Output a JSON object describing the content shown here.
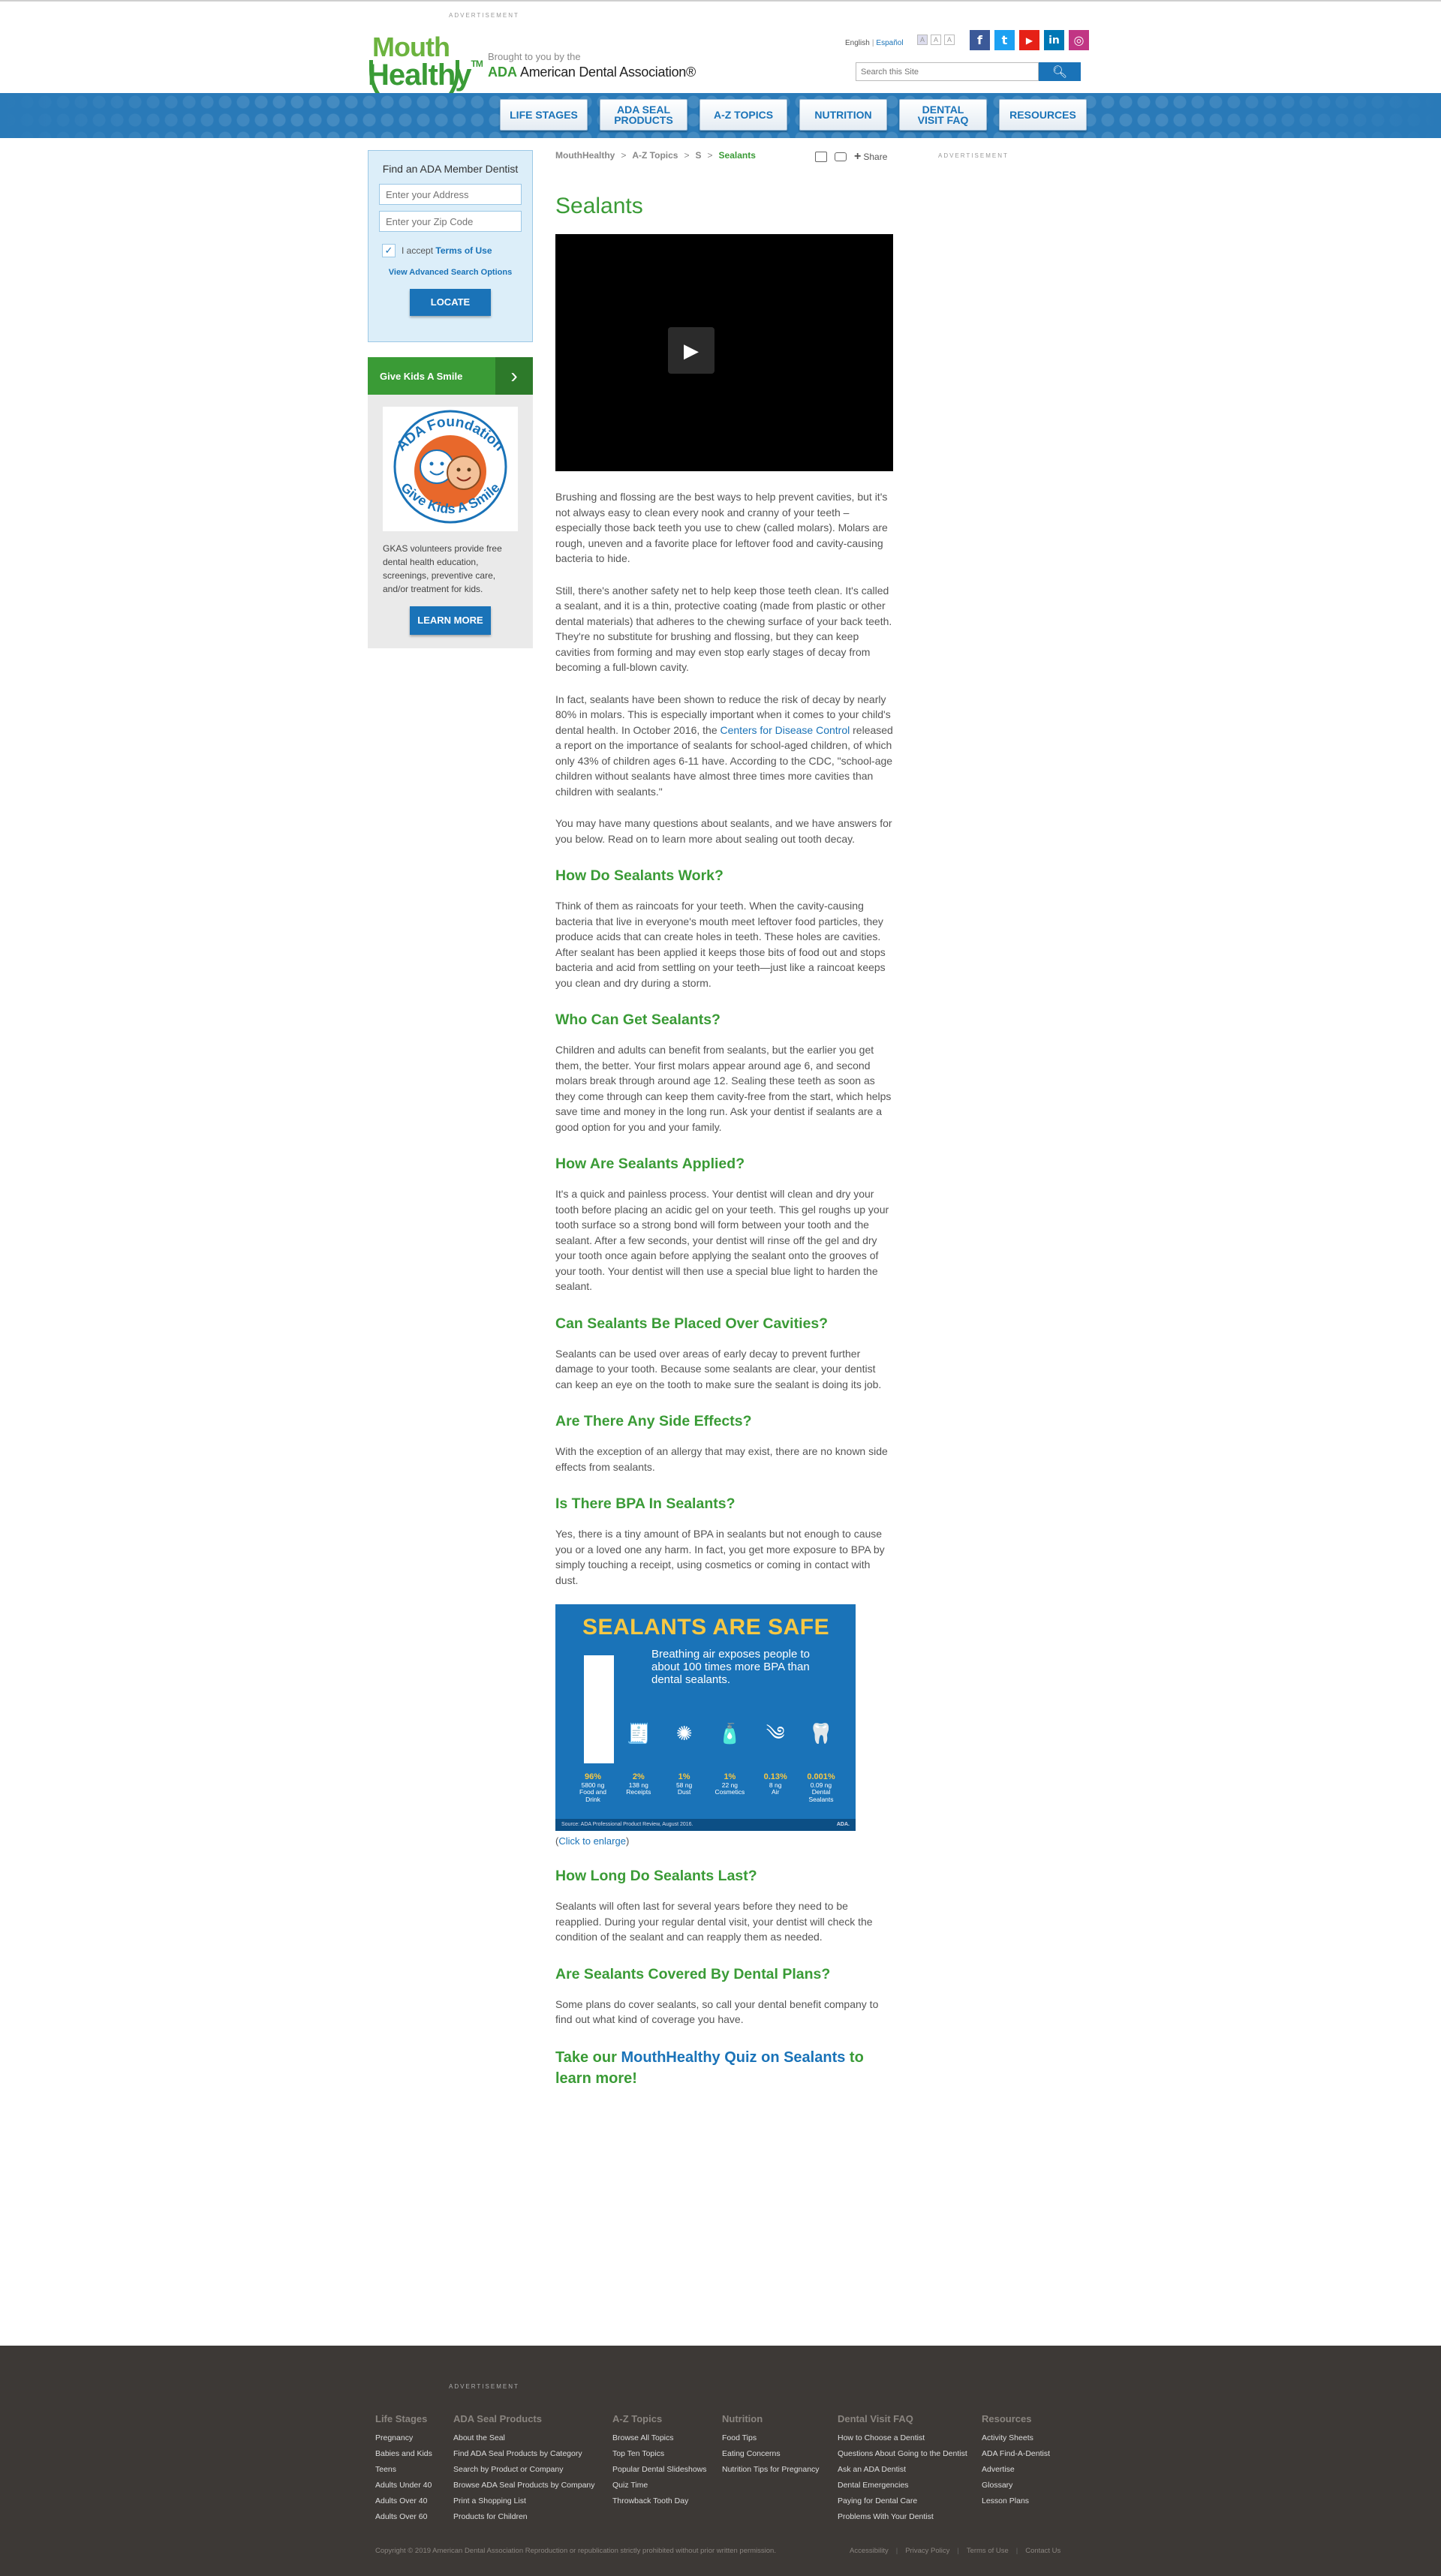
{
  "header": {
    "advertisement_label": "ADVERTISEMENT",
    "logo_line1": "Mouth",
    "logo_line2": "Healthy",
    "logo_tm": "TM",
    "brought_by": "Brought to you by the",
    "ada_short": "ADA",
    "ada_name": "American Dental Association®",
    "lang_english": "English",
    "lang_espanol": "Español",
    "font_sizes": [
      "A",
      "A",
      "A"
    ],
    "social": [
      {
        "name": "facebook",
        "glyph": "f",
        "color": "#3b5998"
      },
      {
        "name": "twitter",
        "glyph": "t",
        "color": "#1da1f2"
      },
      {
        "name": "youtube",
        "glyph": "▶",
        "color": "#e62117"
      },
      {
        "name": "linkedin",
        "glyph": "in",
        "color": "#0077b5"
      },
      {
        "name": "instagram",
        "glyph": "◎",
        "color": "#c13584"
      }
    ],
    "search_placeholder": "Search this Site"
  },
  "nav": {
    "items": [
      "LIFE STAGES",
      "ADA SEAL PRODUCTS",
      "A-Z TOPICS",
      "NUTRITION",
      "DENTAL VISIT FAQ",
      "RESOURCES"
    ]
  },
  "sidebar": {
    "finder_title": "Find an ADA Member Dentist",
    "address_placeholder": "Enter your Address",
    "zip_placeholder": "Enter your Zip Code",
    "accept_text": "I accept",
    "terms_link": "Terms of Use",
    "advanced": "View Advanced Search Options",
    "locate": "LOCATE",
    "gkas_banner": "Give Kids A Smile",
    "gkas_logo_top": "ADA Foundation",
    "gkas_logo_bottom": "Give Kids A Smile",
    "gkas_text": "GKAS volunteers provide free dental health education, screenings, preventive care, and/or treatment for kids.",
    "learn_more": "LEARN MORE"
  },
  "breadcrumb": [
    "MouthHealthy",
    "A-Z Topics",
    "S",
    "Sealants"
  ],
  "tools": {
    "share": "Share"
  },
  "right_ad_label": "ADVERTISEMENT",
  "article": {
    "title": "Sealants",
    "p1": "Brushing and flossing are the best ways to help prevent cavities, but it's not always easy to clean every nook and cranny of your teeth – especially those back teeth you use to chew (called molars). Molars are rough, uneven and a favorite place for leftover food and cavity-causing bacteria to hide.",
    "p2": "Still, there's another safety net to help keep those teeth clean. It's called a sealant, and it is a thin, protective coating (made from plastic or other dental materials) that adheres to the chewing surface of your back teeth. They're no substitute for brushing and flossing, but they can keep cavities from forming and may even stop early stages of decay from becoming a full-blown cavity.",
    "p3_a": "In fact, sealants have been shown to reduce the risk of decay by nearly 80% in molars. This is especially important when it comes to your child's dental health. In October 2016, the ",
    "p3_link": "Centers for Disease Control",
    "p3_b": " released a report on the importance of sealants for school-aged children, of which only 43% of children ages 6-11 have. According to the CDC, \"school-age children without sealants have almost three times more cavities than children with sealants.\"",
    "p4": "You may have many questions about sealants, and we have answers for you below. Read on to learn more about sealing out tooth decay.",
    "h_work": "How Do Sealants Work?",
    "p_work": "Think of them as raincoats for your teeth. When the cavity-causing bacteria that live in everyone's mouth meet leftover food particles, they produce acids that can create holes in teeth. These holes are cavities. After sealant has been applied it keeps those bits of food out and stops bacteria and acid from settling on your teeth—just like a raincoat keeps you clean and dry during a storm.",
    "h_who": "Who Can Get Sealants?",
    "p_who": "Children and adults can benefit from sealants, but the earlier you get them, the better. Your first molars appear around age 6, and second molars break through around age 12. Sealing these teeth as soon as they come through can keep them cavity-free from the start, which helps save time and money in the long run. Ask your dentist if sealants are a good option for you and your family.",
    "h_applied": "How Are Sealants Applied?",
    "p_applied": "It's a quick and painless process. Your dentist will clean and dry your tooth before placing an acidic gel on your teeth. This gel roughs up your tooth surface so a strong bond will form between your tooth and the sealant. After a few seconds, your dentist will rinse off the gel and dry your tooth once again before applying the sealant onto the grooves of your tooth. Your dentist will then use a special blue light to harden the sealant.",
    "h_cavities": "Can Sealants Be Placed Over Cavities?",
    "p_cavities": "Sealants can be used over areas of early decay to prevent further damage to your tooth. Because some sealants are clear, your dentist can keep an eye on the tooth to make sure the sealant is doing its job.",
    "h_side": "Are There Any Side Effects?",
    "p_side": "With the exception of an allergy that may exist, there are no known side effects from sealants.",
    "h_bpa": "Is There BPA In Sealants?",
    "p_bpa": "Yes, there is a tiny amount of BPA in sealants but not enough to cause you or a loved one any harm. In fact, you get more exposure to BPA by simply touching a receipt, using cosmetics or coming in contact with dust.",
    "enlarge_open": "(",
    "enlarge_link": "Click to enlarge",
    "enlarge_close": ")",
    "h_last": "How Long Do Sealants Last?",
    "p_last": "Sealants will often last for several years before they need to be reapplied. During your regular dental visit, your dentist will check the condition of the sealant and can reapply them as needed.",
    "h_covered": "Are Sealants Covered By Dental Plans?",
    "p_covered": "Some plans do cover sealants, so call your dental benefit company to find out what kind of coverage you have.",
    "quiz_a": "Take our ",
    "quiz_link": "MouthHealthy Quiz on Sealants",
    "quiz_b": " to learn more!"
  },
  "infographic": {
    "heading": "SEALANTS ARE SAFE",
    "subheading": "Breathing air exposes people to about 100 times more BPA than dental sealants.",
    "items": [
      {
        "pct": "96%",
        "amount": "5800 ng",
        "label": "Food and Drink",
        "icon": "🥛",
        "share": 0.96
      },
      {
        "pct": "2%",
        "amount": "138 ng",
        "label": "Receipts",
        "icon": "🧾",
        "share": 0.02
      },
      {
        "pct": "1%",
        "amount": "58 ng",
        "label": "Dust",
        "icon": "✺",
        "share": 0.01
      },
      {
        "pct": "1%",
        "amount": "22 ng",
        "label": "Cosmetics",
        "icon": "🧴",
        "share": 0.01
      },
      {
        "pct": "0.13%",
        "amount": "8 ng",
        "label": "Air",
        "icon": "༄",
        "share": 0.0013
      },
      {
        "pct": "0.001%",
        "amount": "0.09 ng",
        "label": "Dental Sealants",
        "icon": "🦷",
        "share": 1e-05
      }
    ],
    "source": "Source: ADA Professional Product Review, August 2016.",
    "brand": "ADA."
  },
  "footer": {
    "advertisement_label": "ADVERTISEMENT",
    "columns": [
      {
        "title": "Life Stages",
        "links": [
          "Pregnancy",
          "Babies and Kids",
          "Teens",
          "Adults Under 40",
          "Adults Over 40",
          "Adults Over 60"
        ]
      },
      {
        "title": "ADA Seal Products",
        "links": [
          "About the Seal",
          "Find ADA Seal Products by Category",
          "Search by Product or Company",
          "Browse ADA Seal Products by Company",
          "Print a Shopping List",
          "Products for Children"
        ]
      },
      {
        "title": "A-Z Topics",
        "links": [
          "Browse All Topics",
          "Top Ten Topics",
          "Popular Dental Slideshows",
          "Quiz Time",
          "Throwback Tooth Day"
        ]
      },
      {
        "title": "Nutrition",
        "links": [
          "Food Tips",
          "Eating Concerns",
          "Nutrition Tips for Pregnancy"
        ]
      },
      {
        "title": "Dental Visit FAQ",
        "links": [
          "How to Choose a Dentist",
          "Questions About Going to the Dentist",
          "Ask an ADA Dentist",
          "Dental Emergencies",
          "Paying for Dental Care",
          "Problems With Your Dentist"
        ]
      },
      {
        "title": "Resources",
        "links": [
          "Activity Sheets",
          "ADA Find-A-Dentist",
          "Advertise",
          "Glossary",
          "Lesson Plans"
        ]
      }
    ],
    "copyright": "Copyright © 2019 American Dental Association Reproduction or republication strictly prohibited without prior written permission.",
    "bottom_links": [
      "Accessibility",
      "Privacy Policy",
      "Terms of Use",
      "Contact Us"
    ]
  }
}
